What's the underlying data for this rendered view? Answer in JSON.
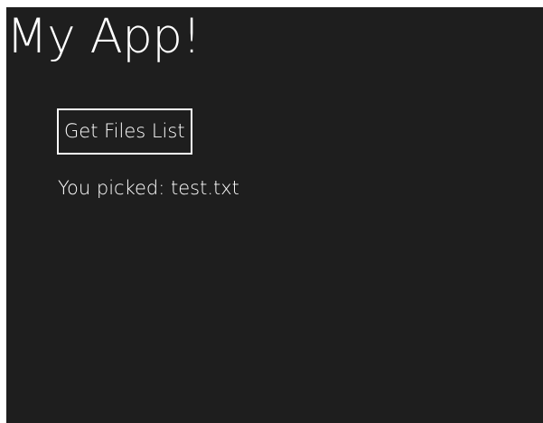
{
  "app": {
    "title": "My App!"
  },
  "actions": {
    "get_files_label": "Get Files List"
  },
  "result": {
    "prefix": "You picked:",
    "filename": "test.txt"
  },
  "colors": {
    "background": "#1e1e1e",
    "foreground": "#ffffff"
  }
}
